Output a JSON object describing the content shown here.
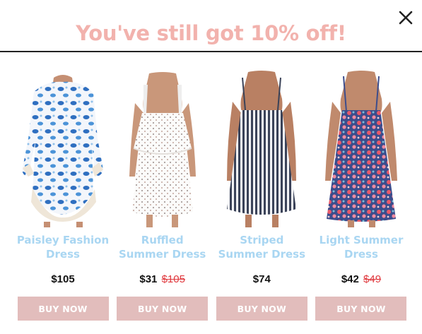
{
  "popup": {
    "headline": "You've still got 10% off!",
    "colors": {
      "headline": "#f2b2ad",
      "product_name": "#a9d6f2",
      "button_bg": "#e2bdbc",
      "old_price": "#e0393e"
    }
  },
  "products": [
    {
      "name": "Paisley Fashion Dress",
      "price": "$105",
      "old_price": "",
      "button": "BUY NOW",
      "image": "paisley-dress-image"
    },
    {
      "name": "Ruffled Summer Dress",
      "price": "$31",
      "old_price": "$105",
      "button": "BUY NOW",
      "image": "ruffled-dress-image"
    },
    {
      "name": "Striped Summer Dress",
      "price": "$74",
      "old_price": "",
      "button": "BUY NOW",
      "image": "striped-dress-image"
    },
    {
      "name": "Light Summer Dress",
      "price": "$42",
      "old_price": "$49",
      "button": "BUY NOW",
      "image": "floral-dress-image"
    }
  ]
}
